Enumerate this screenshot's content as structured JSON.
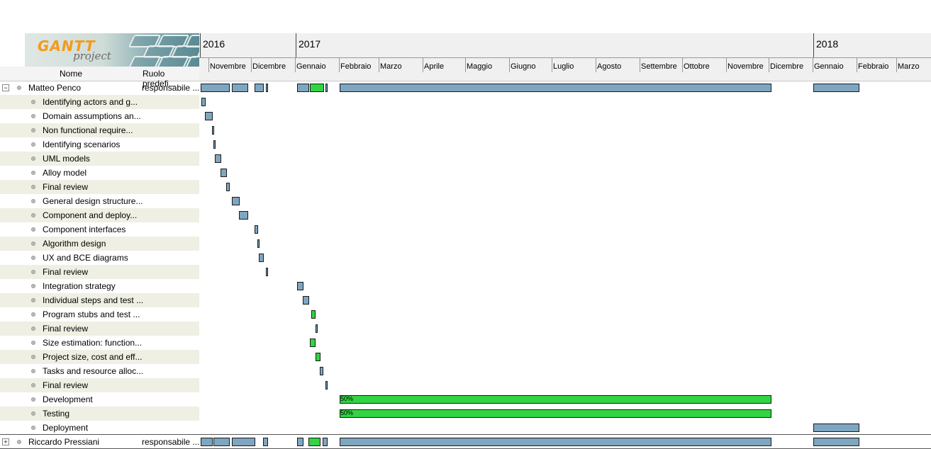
{
  "logo": {
    "text_main": "GANTT",
    "text_sub": "project"
  },
  "columns": {
    "name": "Nome",
    "role": "Ruolo predefi..."
  },
  "timeline": {
    "years": [
      {
        "label": "2016"
      },
      {
        "label": "2017"
      },
      {
        "label": "2018"
      }
    ],
    "months": [
      "Novembre",
      "Dicembre",
      "Gennaio",
      "Febbraio",
      "Marzo",
      "Aprile",
      "Maggio",
      "Giugno",
      "Luglio",
      "Agosto",
      "Settembre",
      "Ottobre",
      "Novembre",
      "Dicembre",
      "Gennaio",
      "Febbraio",
      "Marzo"
    ]
  },
  "resources": [
    {
      "name": "Matteo Penco",
      "role": "responsabile ...",
      "expanded": true,
      "expander": "−"
    },
    {
      "name": "Riccardo Pressiani",
      "role": "responsabile ...",
      "expanded": false,
      "expander": "+"
    }
  ],
  "tasks": [
    {
      "name": "Identifying actors and g..."
    },
    {
      "name": "Domain assumptions an..."
    },
    {
      "name": "Non functional require..."
    },
    {
      "name": "Identifying scenarios"
    },
    {
      "name": "UML models"
    },
    {
      "name": "Alloy model"
    },
    {
      "name": "Final review"
    },
    {
      "name": "General design structure..."
    },
    {
      "name": "Component and deploy..."
    },
    {
      "name": "Component interfaces"
    },
    {
      "name": "Algorithm design"
    },
    {
      "name": "UX and BCE diagrams"
    },
    {
      "name": "Final review"
    },
    {
      "name": "Integration strategy"
    },
    {
      "name": "Individual steps and test ..."
    },
    {
      "name": "Program stubs and test ..."
    },
    {
      "name": "Final review"
    },
    {
      "name": "Size estimation: function..."
    },
    {
      "name": "Project size, cost and eff..."
    },
    {
      "name": "Tasks and resource alloc..."
    },
    {
      "name": "Final review"
    },
    {
      "name": "Development",
      "progress": "50%"
    },
    {
      "name": "Testing",
      "progress": "50%"
    },
    {
      "name": "Deployment"
    }
  ],
  "colors": {
    "bar": "#7fa6c1",
    "bar_overload": "#33d444",
    "row_alt": "#efefe3"
  }
}
